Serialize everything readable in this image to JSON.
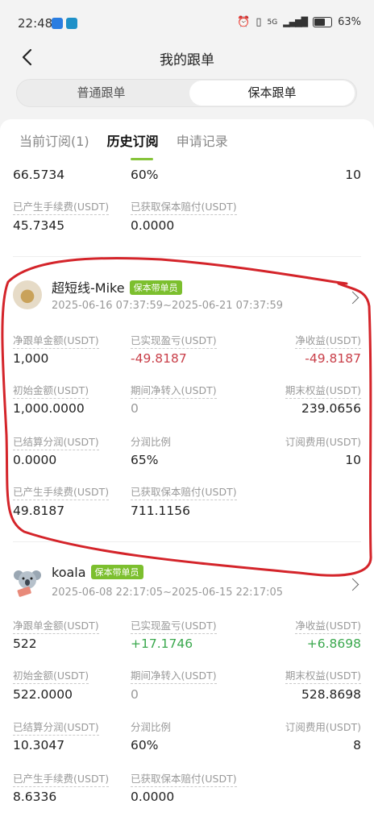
{
  "status": {
    "time": "22:48",
    "battery": "63%",
    "signal": "5G"
  },
  "header": {
    "title": "我的跟单"
  },
  "segment": {
    "tabs": [
      "普通跟单",
      "保本跟单"
    ],
    "active_index": 1
  },
  "subtabs": {
    "items": [
      "当前订阅(1)",
      "历史订阅",
      "申请记录"
    ],
    "active_index": 1
  },
  "partial_card": {
    "row_top": [
      "66.5734",
      "60%",
      "10"
    ],
    "labels": [
      "已产生手续费(USDT)",
      "已获取保本赔付(USDT)"
    ],
    "values": [
      "45.7345",
      "0.0000"
    ]
  },
  "cards": [
    {
      "name": "超短线-Mike",
      "badge": "保本带单员",
      "period": "2025-06-16 07:37:59~2025-06-21 07:37:59",
      "rows": [
        {
          "labels": [
            "净跟单金额(USDT)",
            "已实现盈亏(USDT)",
            "净收益(USDT)"
          ],
          "values": [
            "1,000",
            "-49.8187",
            "-49.8187"
          ]
        },
        {
          "labels": [
            "初始金额(USDT)",
            "期间净转入(USDT)",
            "期末权益(USDT)"
          ],
          "values": [
            "1,000.0000",
            "0",
            "239.0656"
          ]
        },
        {
          "labels": [
            "已结算分润(USDT)",
            "分润比例",
            "订阅费用(USDT)"
          ],
          "values": [
            "0.0000",
            "65%",
            "10"
          ]
        },
        {
          "labels": [
            "已产生手续费(USDT)",
            "已获取保本赔付(USDT)"
          ],
          "values": [
            "49.8187",
            "711.1156"
          ]
        }
      ]
    },
    {
      "name": "koala",
      "badge": "保本带单员",
      "period": "2025-06-08 22:17:05~2025-06-15 22:17:05",
      "rows": [
        {
          "labels": [
            "净跟单金额(USDT)",
            "已实现盈亏(USDT)",
            "净收益(USDT)"
          ],
          "values": [
            "522",
            "+17.1746",
            "+6.8698"
          ]
        },
        {
          "labels": [
            "初始金额(USDT)",
            "期间净转入(USDT)",
            "期末权益(USDT)"
          ],
          "values": [
            "522.0000",
            "0",
            "528.8698"
          ]
        },
        {
          "labels": [
            "已结算分润(USDT)",
            "分润比例",
            "订阅费用(USDT)"
          ],
          "values": [
            "10.3047",
            "60%",
            "8"
          ]
        },
        {
          "labels": [
            "已产生手续费(USDT)",
            "已获取保本赔付(USDT)"
          ],
          "values": [
            "8.6336",
            "0.0000"
          ]
        }
      ]
    }
  ],
  "colors": {
    "accent_green": "#7cbf2e",
    "loss_red": "#c9404a",
    "gain_green": "#3aa84d",
    "annotation_red": "#d4242a"
  }
}
